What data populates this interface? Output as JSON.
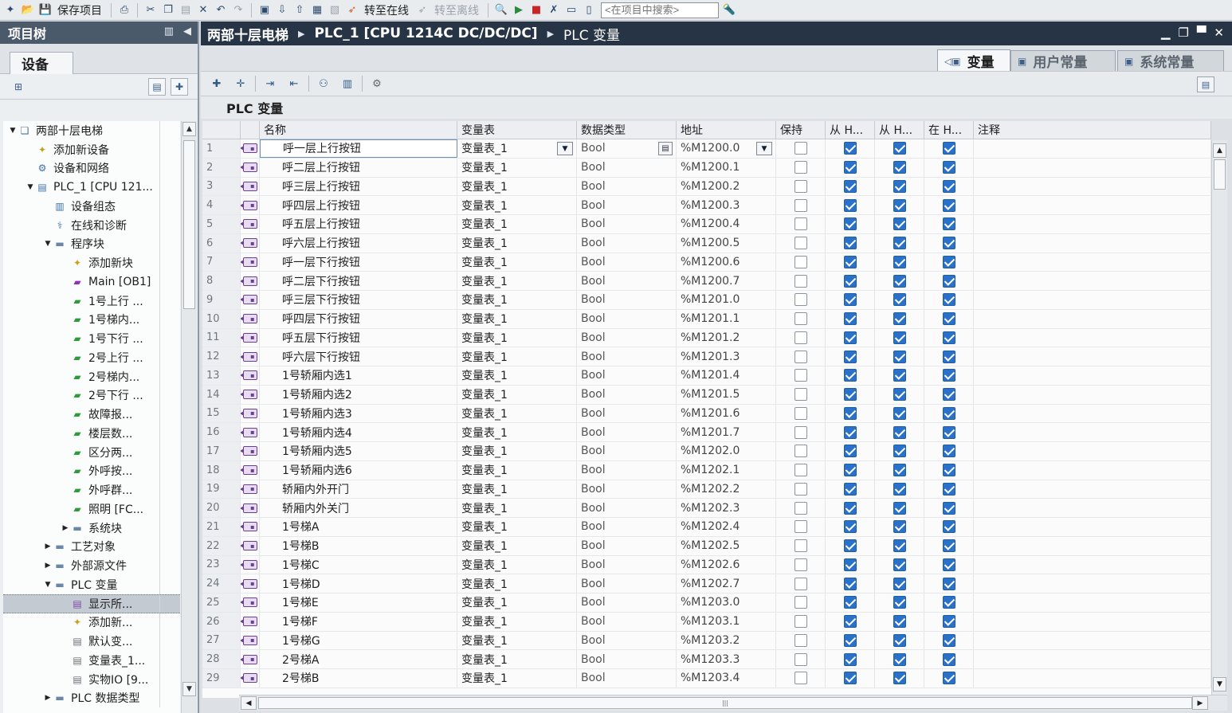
{
  "toolbar": {
    "save_label": "保存项目",
    "go_online_label": "转至在线",
    "go_offline_label": "转至离线",
    "search_placeholder": "<在项目中搜索>"
  },
  "project_tree": {
    "title": "项目树",
    "tab_label": "设备",
    "items": [
      {
        "label": "两部十层电梯",
        "level": 0,
        "arrow": "down",
        "icon": "project-icon"
      },
      {
        "label": "添加新设备",
        "level": 1,
        "arrow": "",
        "icon": "add-device-icon"
      },
      {
        "label": "设备和网络",
        "level": 1,
        "arrow": "",
        "icon": "network-icon"
      },
      {
        "label": "PLC_1 [CPU 121...",
        "level": 1,
        "arrow": "down",
        "icon": "plc-icon"
      },
      {
        "label": "设备组态",
        "level": 2,
        "arrow": "",
        "icon": "device-config-icon"
      },
      {
        "label": "在线和诊断",
        "level": 2,
        "arrow": "",
        "icon": "diagnostics-icon"
      },
      {
        "label": "程序块",
        "level": 2,
        "arrow": "down",
        "icon": "folder-icon"
      },
      {
        "label": "添加新块",
        "level": 3,
        "arrow": "",
        "icon": "add-block-icon"
      },
      {
        "label": "Main [OB1]",
        "level": 3,
        "arrow": "",
        "icon": "ob-block-icon"
      },
      {
        "label": "1号上行 ...",
        "level": 3,
        "arrow": "",
        "icon": "fc-block-icon"
      },
      {
        "label": "1号梯内...",
        "level": 3,
        "arrow": "",
        "icon": "fc-block-icon"
      },
      {
        "label": "1号下行 ...",
        "level": 3,
        "arrow": "",
        "icon": "fc-block-icon"
      },
      {
        "label": "2号上行 ...",
        "level": 3,
        "arrow": "",
        "icon": "fc-block-icon"
      },
      {
        "label": "2号梯内...",
        "level": 3,
        "arrow": "",
        "icon": "fc-block-icon"
      },
      {
        "label": "2号下行 ...",
        "level": 3,
        "arrow": "",
        "icon": "fc-block-icon"
      },
      {
        "label": "故障报...",
        "level": 3,
        "arrow": "",
        "icon": "fc-block-icon"
      },
      {
        "label": "楼层数...",
        "level": 3,
        "arrow": "",
        "icon": "fc-block-icon"
      },
      {
        "label": "区分两...",
        "level": 3,
        "arrow": "",
        "icon": "fc-block-icon"
      },
      {
        "label": "外呼按...",
        "level": 3,
        "arrow": "",
        "icon": "fc-block-icon"
      },
      {
        "label": "外呼群...",
        "level": 3,
        "arrow": "",
        "icon": "fc-block-icon"
      },
      {
        "label": "照明 [FC...",
        "level": 3,
        "arrow": "",
        "icon": "fc-block-icon"
      },
      {
        "label": "系统块",
        "level": 3,
        "arrow": "right",
        "icon": "folder-icon"
      },
      {
        "label": "工艺对象",
        "level": 2,
        "arrow": "right",
        "icon": "folder-icon"
      },
      {
        "label": "外部源文件",
        "level": 2,
        "arrow": "right",
        "icon": "folder-icon"
      },
      {
        "label": "PLC 变量",
        "level": 2,
        "arrow": "down",
        "icon": "folder-icon"
      },
      {
        "label": "显示所...",
        "level": 3,
        "arrow": "",
        "icon": "tag-table-all-icon",
        "selected": true
      },
      {
        "label": "添加新...",
        "level": 3,
        "arrow": "",
        "icon": "add-tag-table-icon"
      },
      {
        "label": "默认变...",
        "level": 3,
        "arrow": "",
        "icon": "tag-table-icon"
      },
      {
        "label": "变量表_1...",
        "level": 3,
        "arrow": "",
        "icon": "tag-table-icon"
      },
      {
        "label": "实物IO [9...",
        "level": 3,
        "arrow": "",
        "icon": "tag-table-icon"
      },
      {
        "label": "PLC 数据类型",
        "level": 2,
        "arrow": "right",
        "icon": "folder-icon"
      }
    ]
  },
  "breadcrumb": [
    "两部十层电梯",
    "PLC_1 [CPU 1214C DC/DC/DC]",
    "PLC 变量"
  ],
  "view_tabs": [
    "变量",
    "用户常量",
    "系统常量"
  ],
  "table": {
    "title": "PLC 变量",
    "columns": [
      "名称",
      "变量表",
      "数据类型",
      "地址",
      "保持",
      "从 H...",
      "从 H...",
      "在 H...",
      "注释"
    ],
    "rows": [
      {
        "n": "1",
        "name": "呼一层上行按钮",
        "table": "变量表_1",
        "type": "Bool",
        "addr": "%M1200.0"
      },
      {
        "n": "2",
        "name": "呼二层上行按钮",
        "table": "变量表_1",
        "type": "Bool",
        "addr": "%M1200.1"
      },
      {
        "n": "3",
        "name": "呼三层上行按钮",
        "table": "变量表_1",
        "type": "Bool",
        "addr": "%M1200.2"
      },
      {
        "n": "4",
        "name": "呼四层上行按钮",
        "table": "变量表_1",
        "type": "Bool",
        "addr": "%M1200.3"
      },
      {
        "n": "5",
        "name": "呼五层上行按钮",
        "table": "变量表_1",
        "type": "Bool",
        "addr": "%M1200.4"
      },
      {
        "n": "6",
        "name": "呼六层上行按钮",
        "table": "变量表_1",
        "type": "Bool",
        "addr": "%M1200.5"
      },
      {
        "n": "7",
        "name": "呼一层下行按钮",
        "table": "变量表_1",
        "type": "Bool",
        "addr": "%M1200.6"
      },
      {
        "n": "8",
        "name": "呼二层下行按钮",
        "table": "变量表_1",
        "type": "Bool",
        "addr": "%M1200.7"
      },
      {
        "n": "9",
        "name": "呼三层下行按钮",
        "table": "变量表_1",
        "type": "Bool",
        "addr": "%M1201.0"
      },
      {
        "n": "10",
        "name": "呼四层下行按钮",
        "table": "变量表_1",
        "type": "Bool",
        "addr": "%M1201.1"
      },
      {
        "n": "11",
        "name": "呼五层下行按钮",
        "table": "变量表_1",
        "type": "Bool",
        "addr": "%M1201.2"
      },
      {
        "n": "12",
        "name": "呼六层下行按钮",
        "table": "变量表_1",
        "type": "Bool",
        "addr": "%M1201.3"
      },
      {
        "n": "13",
        "name": "1号轿厢内选1",
        "table": "变量表_1",
        "type": "Bool",
        "addr": "%M1201.4"
      },
      {
        "n": "14",
        "name": "1号轿厢内选2",
        "table": "变量表_1",
        "type": "Bool",
        "addr": "%M1201.5"
      },
      {
        "n": "15",
        "name": "1号轿厢内选3",
        "table": "变量表_1",
        "type": "Bool",
        "addr": "%M1201.6"
      },
      {
        "n": "16",
        "name": "1号轿厢内选4",
        "table": "变量表_1",
        "type": "Bool",
        "addr": "%M1201.7"
      },
      {
        "n": "17",
        "name": "1号轿厢内选5",
        "table": "变量表_1",
        "type": "Bool",
        "addr": "%M1202.0"
      },
      {
        "n": "18",
        "name": "1号轿厢内选6",
        "table": "变量表_1",
        "type": "Bool",
        "addr": "%M1202.1"
      },
      {
        "n": "19",
        "name": "轿厢内外开门",
        "table": "变量表_1",
        "type": "Bool",
        "addr": "%M1202.2"
      },
      {
        "n": "20",
        "name": "轿厢内外关门",
        "table": "变量表_1",
        "type": "Bool",
        "addr": "%M1202.3"
      },
      {
        "n": "21",
        "name": "1号梯A",
        "table": "变量表_1",
        "type": "Bool",
        "addr": "%M1202.4"
      },
      {
        "n": "22",
        "name": "1号梯B",
        "table": "变量表_1",
        "type": "Bool",
        "addr": "%M1202.5"
      },
      {
        "n": "23",
        "name": "1号梯C",
        "table": "变量表_1",
        "type": "Bool",
        "addr": "%M1202.6"
      },
      {
        "n": "24",
        "name": "1号梯D",
        "table": "变量表_1",
        "type": "Bool",
        "addr": "%M1202.7"
      },
      {
        "n": "25",
        "name": "1号梯E",
        "table": "变量表_1",
        "type": "Bool",
        "addr": "%M1203.0"
      },
      {
        "n": "26",
        "name": "1号梯F",
        "table": "变量表_1",
        "type": "Bool",
        "addr": "%M1203.1"
      },
      {
        "n": "27",
        "name": "1号梯G",
        "table": "变量表_1",
        "type": "Bool",
        "addr": "%M1203.2"
      },
      {
        "n": "28",
        "name": "2号梯A",
        "table": "变量表_1",
        "type": "Bool",
        "addr": "%M1203.3"
      },
      {
        "n": "29",
        "name": "2号梯B",
        "table": "变量表_1",
        "type": "Bool",
        "addr": "%M1203.4"
      }
    ]
  },
  "colors": {
    "breadcrumb_bg": "#263445",
    "panel_header_bg": "#4b5a6b",
    "checkbox_checked": "#2a72c9",
    "tag_icon": "#6b3f8e"
  }
}
